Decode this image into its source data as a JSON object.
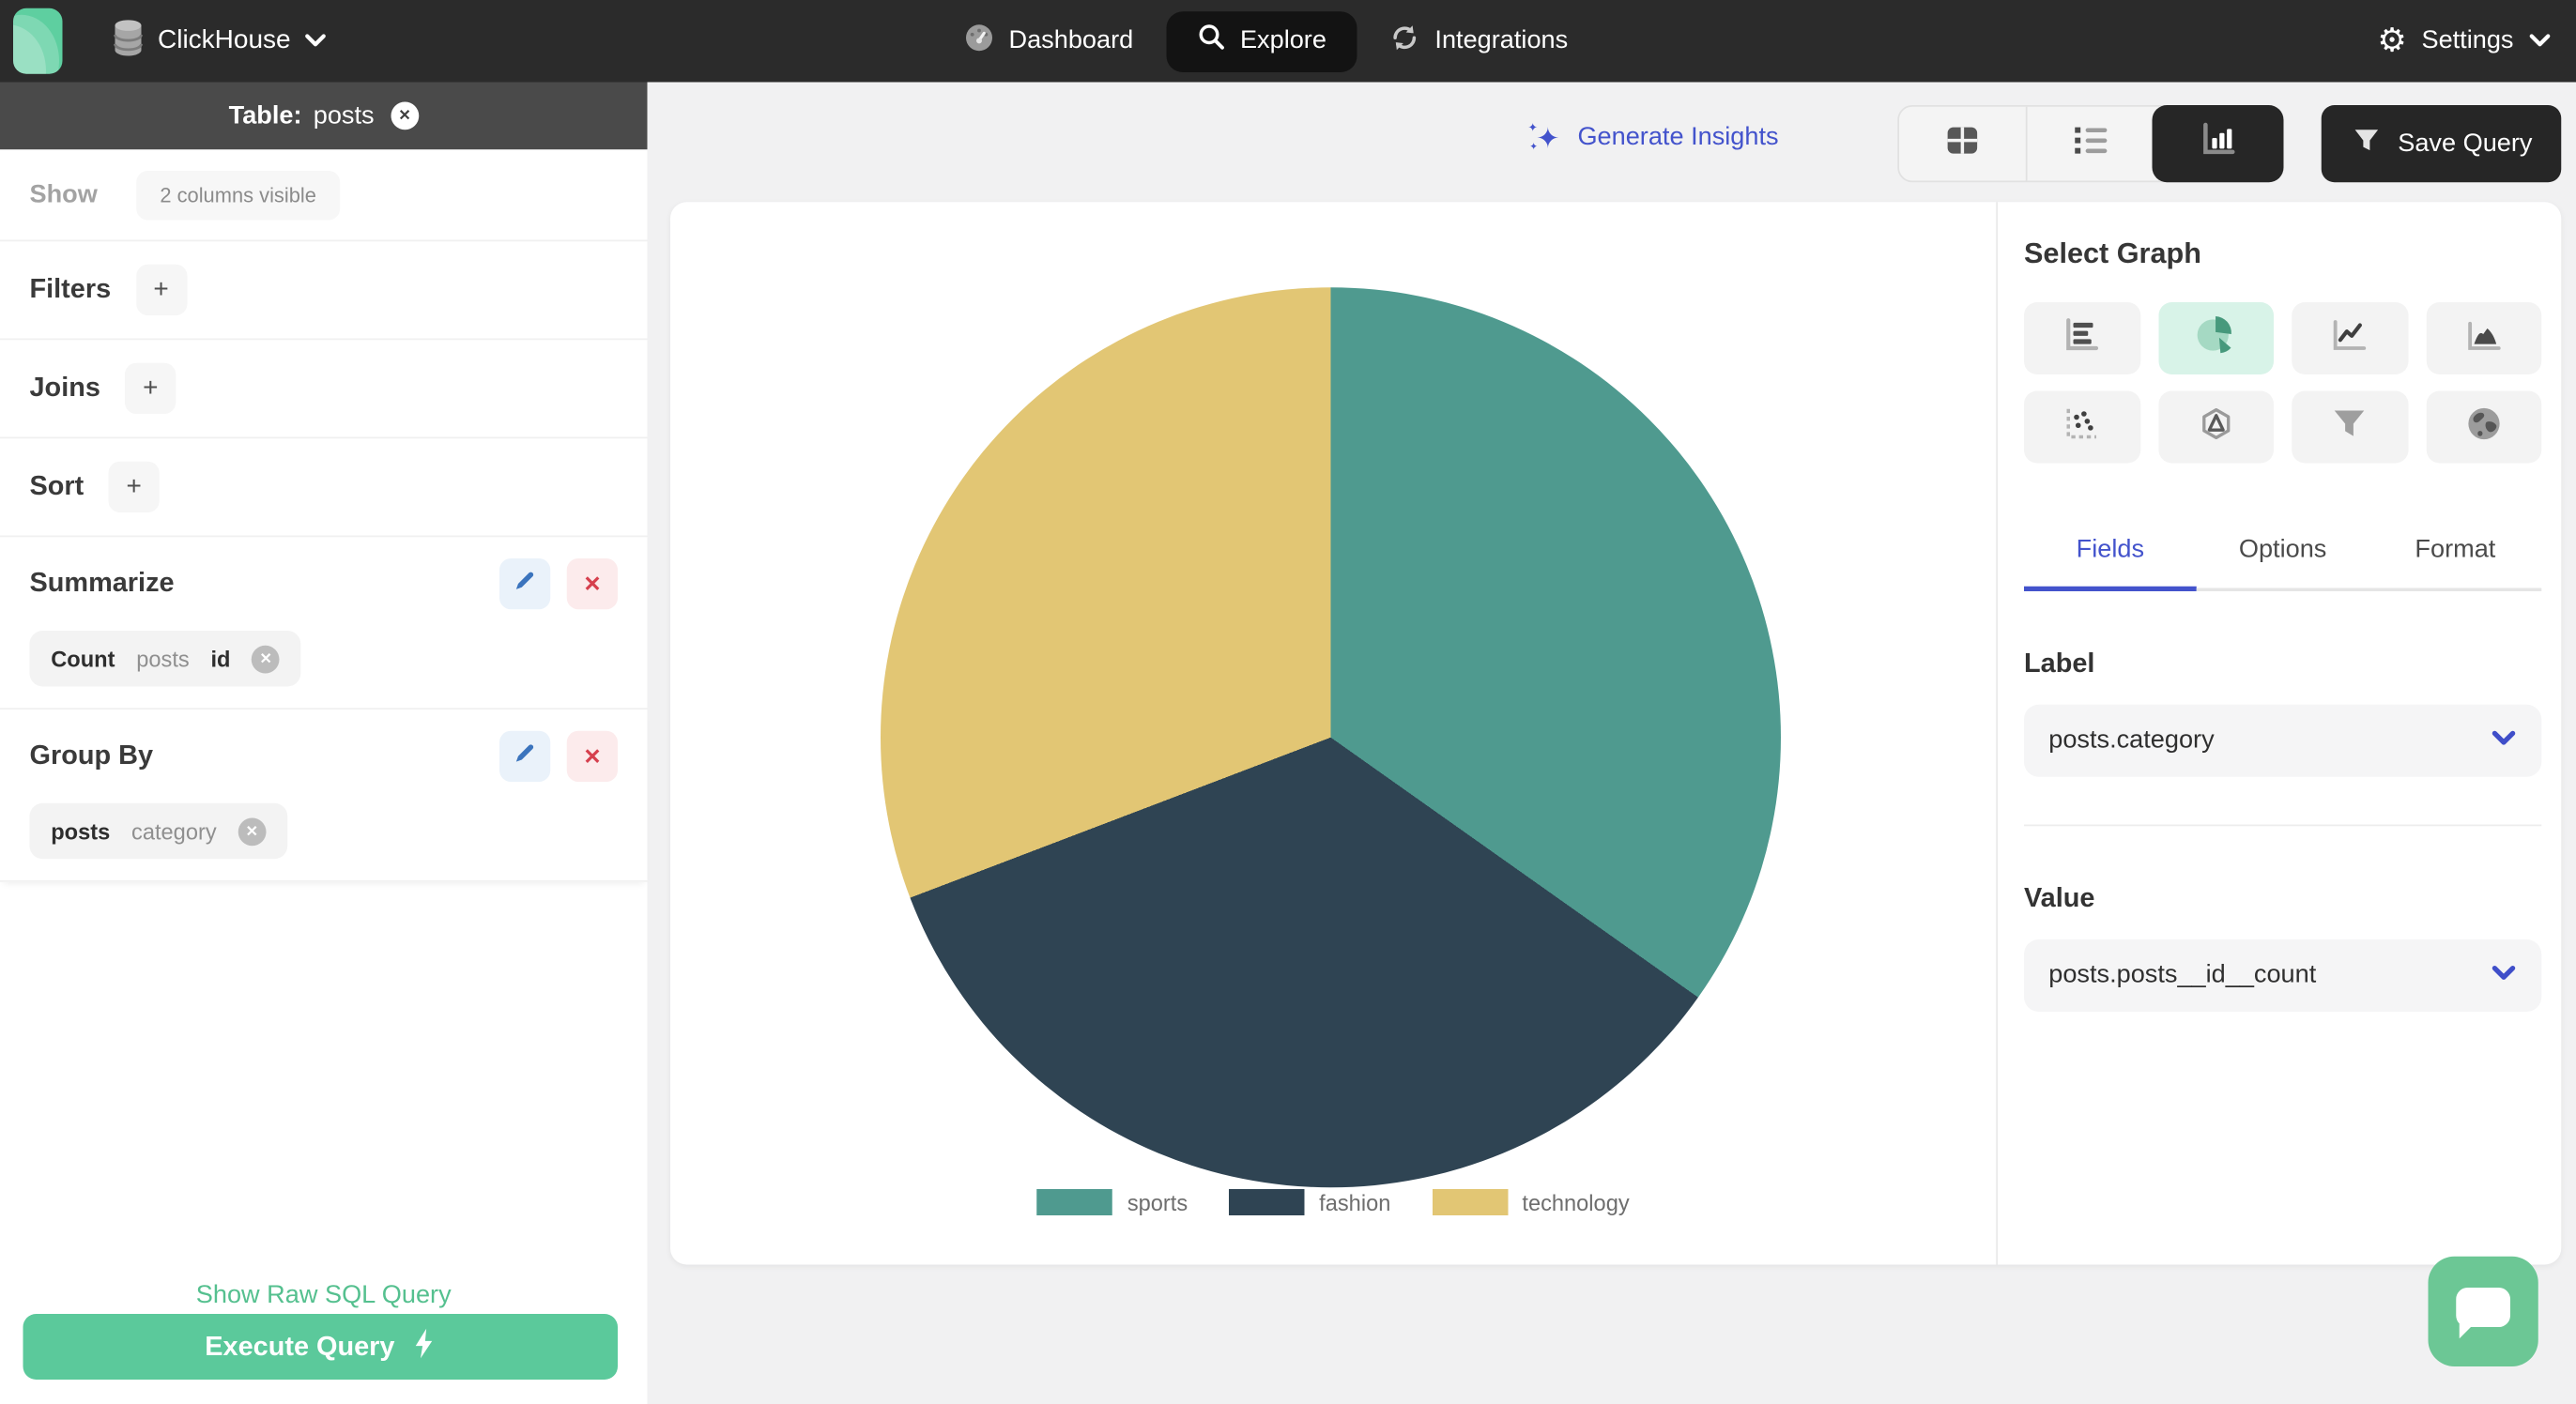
{
  "navbar": {
    "brand": "ClickHouse",
    "items": [
      {
        "label": "Dashboard",
        "icon": "gauge-icon",
        "active": false
      },
      {
        "label": "Explore",
        "icon": "search-icon",
        "active": true
      },
      {
        "label": "Integrations",
        "icon": "sync-icon",
        "active": false
      }
    ],
    "settings": {
      "label": "Settings",
      "icon": "gear-icon"
    }
  },
  "sidebar": {
    "table_header": {
      "prefix": "Table:",
      "table_name": "posts"
    },
    "show_row": {
      "label": "Show",
      "columns_pill": "2 columns visible"
    },
    "filters": {
      "label": "Filters",
      "add_label": "+"
    },
    "joins": {
      "label": "Joins",
      "add_label": "+"
    },
    "sort": {
      "label": "Sort",
      "add_label": "+"
    },
    "summarize": {
      "title": "Summarize",
      "chip": {
        "aggregate": "Count",
        "table": "posts",
        "column": "id"
      }
    },
    "group_by": {
      "title": "Group By",
      "chip": {
        "table": "posts",
        "column": "category"
      }
    },
    "raw_sql_link": "Show Raw SQL Query",
    "execute_button": "Execute Query"
  },
  "toolbar": {
    "generate_insights": "Generate Insights",
    "save_query": "Save Query",
    "view_toggles": [
      {
        "icon": "table-view-icon",
        "active": false
      },
      {
        "icon": "list-view-icon",
        "active": false
      },
      {
        "icon": "chart-view-icon",
        "active": true
      }
    ]
  },
  "graph_panel": {
    "title": "Select Graph",
    "graph_types": [
      {
        "name": "bar",
        "active": false
      },
      {
        "name": "pie",
        "active": true
      },
      {
        "name": "line",
        "active": false
      },
      {
        "name": "area",
        "active": false
      },
      {
        "name": "scatter",
        "active": false
      },
      {
        "name": "radar",
        "active": false
      },
      {
        "name": "funnel",
        "active": false
      },
      {
        "name": "map",
        "active": false
      }
    ],
    "tabs": [
      {
        "label": "Fields",
        "active": true
      },
      {
        "label": "Options",
        "active": false
      },
      {
        "label": "Format",
        "active": false
      }
    ],
    "label_field": {
      "heading": "Label",
      "value": "posts.category"
    },
    "value_field": {
      "heading": "Value",
      "value": "posts.posts__id__count"
    }
  },
  "chart_data": {
    "type": "pie",
    "categories": [
      "sports",
      "fashion",
      "technology"
    ],
    "values": [
      34.8,
      34.4,
      30.8
    ],
    "colors": [
      "#4f9a8f",
      "#2f4453",
      "#e2c674"
    ],
    "legend_position": "bottom",
    "title": ""
  },
  "colors": {
    "accent_green": "#5bc99b",
    "accent_indigo": "#4353cc",
    "navbar_bg": "#2b2b2b",
    "active_pill_bg": "#131313",
    "active_graph_bg": "#d8f3e8"
  }
}
